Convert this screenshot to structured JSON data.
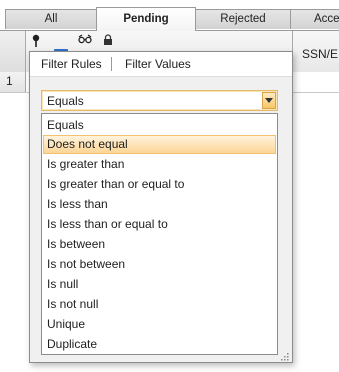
{
  "tabs": [
    {
      "label": "All"
    },
    {
      "label": "Pending"
    },
    {
      "label": "Rejected"
    },
    {
      "label": "Acce"
    }
  ],
  "grid": {
    "columns": [
      {
        "label": "SSN/E"
      }
    ],
    "rows": [
      {
        "number": "1"
      }
    ]
  },
  "filter_popup": {
    "tabs": [
      {
        "label": "Filter Rules"
      },
      {
        "label": "Filter Values"
      }
    ],
    "operator_combo": {
      "value": "Equals"
    },
    "options": [
      {
        "label": "Equals"
      },
      {
        "label": "Does not equal"
      },
      {
        "label": "Is greater than"
      },
      {
        "label": "Is greater than or equal to"
      },
      {
        "label": "Is less than"
      },
      {
        "label": "Is less than or equal to"
      },
      {
        "label": "Is between"
      },
      {
        "label": "Is not between"
      },
      {
        "label": "Is null"
      },
      {
        "label": "Is not null"
      },
      {
        "label": "Unique"
      },
      {
        "label": "Duplicate"
      }
    ],
    "highlighted_option": "Does not equal"
  },
  "icons": {
    "pin": "pin-icon",
    "filter": "filter-icon",
    "glasses": "glasses-icon",
    "lock": "lock-icon",
    "dropdown_arrow": "chevron-down-icon",
    "resize_grip": "resize-grip-icon"
  },
  "colors": {
    "highlight_top": "#fff3dc",
    "highlight_bottom": "#fcd596",
    "highlight_border": "#f1c073",
    "combo_border": "#e5b96a",
    "filter_accent": "#2f6fcc"
  }
}
